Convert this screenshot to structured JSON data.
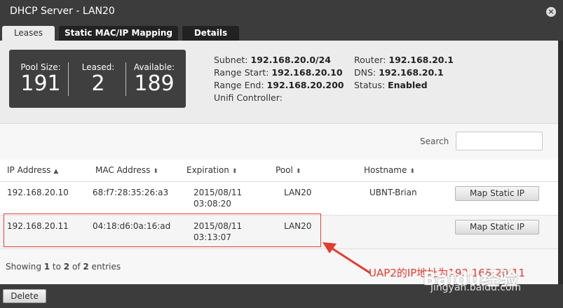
{
  "window": {
    "title": "DHCP Server - LAN20"
  },
  "tabs": [
    {
      "label": "Leases",
      "active": true
    },
    {
      "label": "Static MAC/IP Mapping",
      "active": false
    },
    {
      "label": "Details",
      "active": false
    }
  ],
  "pool": {
    "size_label": "Pool Size:",
    "size_value": "191",
    "leased_label": "Leased:",
    "leased_value": "2",
    "available_label": "Available:",
    "available_value": "189"
  },
  "info": {
    "subnet_label": "Subnet:",
    "subnet_value": "192.168.20.0/24",
    "range_start_label": "Range Start:",
    "range_start_value": "192.168.20.10",
    "range_end_label": "Range End:",
    "range_end_value": "192.168.20.200",
    "controller_label": "Unifi Controller:",
    "router_label": "Router:",
    "router_value": "192.168.20.1",
    "dns_label": "DNS:",
    "dns_value": "192.168.20.1",
    "status_label": "Status:",
    "status_value": "Enabled"
  },
  "search": {
    "label": "Search",
    "value": ""
  },
  "table": {
    "columns": [
      "IP Address",
      "MAC Address",
      "Expiration",
      "Pool",
      "Hostname"
    ],
    "rows": [
      {
        "ip": "192.168.20.10",
        "mac": "68:f7:28:35:26:a3",
        "exp_date": "2015/08/11",
        "exp_time": "03:08:20",
        "pool": "LAN20",
        "hostname": "UBNT-Brian",
        "action": "Map Static IP"
      },
      {
        "ip": "192.168.20.11",
        "mac": "04:18:d6:0a:16:ad",
        "exp_date": "2015/08/11",
        "exp_time": "03:13:07",
        "pool": "LAN20",
        "hostname": "",
        "action": "Map Static IP"
      }
    ]
  },
  "footer": {
    "showing_prefix": "Showing ",
    "from": "1",
    "to_word": " to ",
    "to": "2",
    "of_word": " of ",
    "total": "2",
    "suffix": " entries"
  },
  "actions": {
    "delete_label": "Delete"
  },
  "annotation": {
    "text": "UAP2的IP地址为192.168.20.11"
  },
  "watermark": {
    "text": "Baidu经验",
    "url": "jingyan.baidu.com"
  },
  "colors": {
    "chrome": "#3c3c3c",
    "annotation": "#e53a2f"
  },
  "icons": {
    "close": "close-icon",
    "sort_asc": "sort-asc-icon",
    "sort": "sort-icon"
  }
}
